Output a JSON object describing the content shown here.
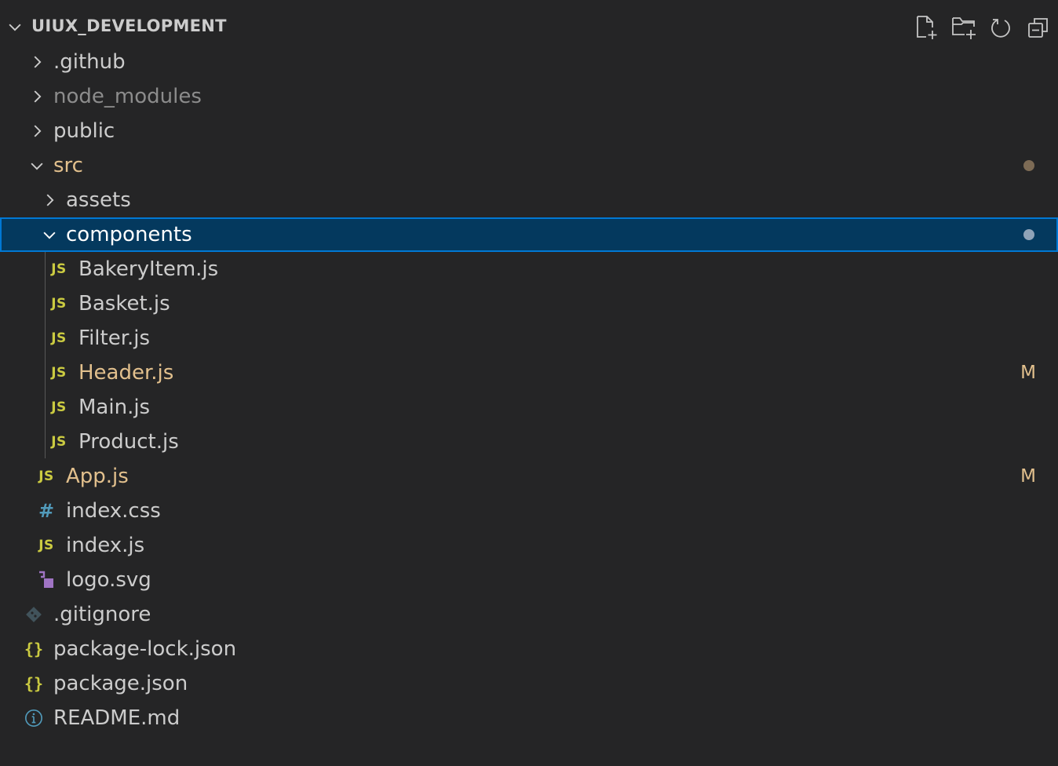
{
  "explorer": {
    "title": "UIUX_DEVELOPMENT",
    "actions": [
      {
        "icon": "new-file-icon"
      },
      {
        "icon": "new-folder-icon"
      },
      {
        "icon": "refresh-icon"
      },
      {
        "icon": "collapse-all-icon"
      }
    ]
  },
  "colors": {
    "background": "#252526",
    "selection_bg": "#04395e",
    "selection_border": "#0078d4",
    "text": "#cccccc",
    "modified": "#e2c08d",
    "ignored": "#8c8c8c",
    "js_icon": "#cbcb41",
    "css_icon": "#519aba",
    "svg_icon": "#a074c4"
  },
  "tree": [
    {
      "label": ".github",
      "type": "folder",
      "expanded": false,
      "depth": 1
    },
    {
      "label": "node_modules",
      "type": "folder",
      "expanded": false,
      "depth": 1,
      "state": "ignored"
    },
    {
      "label": "public",
      "type": "folder",
      "expanded": false,
      "depth": 1
    },
    {
      "label": "src",
      "type": "folder",
      "expanded": true,
      "depth": 1,
      "state": "modified",
      "decoration": "dot"
    },
    {
      "label": "assets",
      "type": "folder",
      "expanded": false,
      "depth": 2
    },
    {
      "label": "components",
      "type": "folder",
      "expanded": true,
      "depth": 2,
      "selected": true,
      "decoration": "dot"
    },
    {
      "label": "BakeryItem.js",
      "type": "js",
      "depth": 3
    },
    {
      "label": "Basket.js",
      "type": "js",
      "depth": 3
    },
    {
      "label": "Filter.js",
      "type": "js",
      "depth": 3
    },
    {
      "label": "Header.js",
      "type": "js",
      "depth": 3,
      "state": "modified",
      "badge": "M"
    },
    {
      "label": "Main.js",
      "type": "js",
      "depth": 3
    },
    {
      "label": "Product.js",
      "type": "js",
      "depth": 3
    },
    {
      "label": "App.js",
      "type": "js",
      "depth": 2,
      "state": "modified",
      "badge": "M"
    },
    {
      "label": "index.css",
      "type": "css",
      "depth": 2
    },
    {
      "label": "index.js",
      "type": "js",
      "depth": 2
    },
    {
      "label": "logo.svg",
      "type": "svg",
      "depth": 2
    },
    {
      "label": ".gitignore",
      "type": "git",
      "depth": 1
    },
    {
      "label": "package-lock.json",
      "type": "json",
      "depth": 1
    },
    {
      "label": "package.json",
      "type": "json",
      "depth": 1
    },
    {
      "label": "README.md",
      "type": "info",
      "depth": 1
    }
  ],
  "icon_glyphs": {
    "js": "JS",
    "css": "#",
    "json": "{}"
  }
}
